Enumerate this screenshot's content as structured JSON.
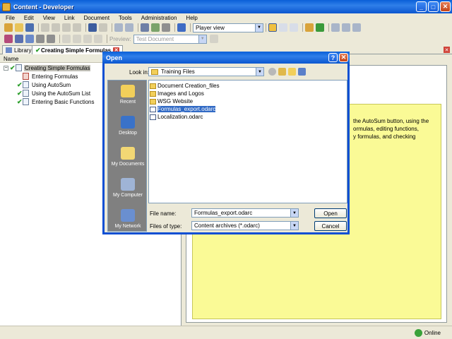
{
  "window": {
    "title": "Content - Developer"
  },
  "menu": [
    "File",
    "Edit",
    "View",
    "Link",
    "Document",
    "Tools",
    "Administration",
    "Help"
  ],
  "toolbar": {
    "view_mode": "Player view",
    "preview_label": "Preview:",
    "preview_value": "Test Document"
  },
  "tabs": [
    {
      "label": "Library"
    },
    {
      "label": "Creating Simple Formulas"
    }
  ],
  "outline": {
    "column_header": "Name",
    "root": "Creating Simple Formulas",
    "children": [
      "Entering Formulas",
      "Using AutoSum",
      "Using the AutoSum List",
      "Entering Basic Functions"
    ]
  },
  "description_lines": [
    "the AutoSum button, using the",
    "ormulas, editing functions,",
    "y formulas, and checking"
  ],
  "dialog": {
    "title": "Open",
    "look_in_label": "Look in:",
    "look_in_value": "Training Files",
    "places": [
      "Recent",
      "Desktop",
      "My Documents",
      "My Computer",
      "My Network"
    ],
    "files": [
      {
        "name": "Document Creation_files",
        "type": "folder"
      },
      {
        "name": "Images and Logos",
        "type": "folder"
      },
      {
        "name": "WSG Website",
        "type": "folder"
      },
      {
        "name": "Formulas_export.odarc",
        "type": "file"
      },
      {
        "name": "Localization.odarc",
        "type": "file"
      }
    ],
    "file_name_label": "File name:",
    "file_name_value": "Formulas_export.odarc",
    "file_type_label": "Files of type:",
    "file_type_value": "Content archives (*.odarc)",
    "open_button": "Open",
    "cancel_button": "Cancel"
  },
  "status": {
    "text": "Online"
  },
  "colors": {
    "title_bar": "#0b56cf",
    "note_background": "#fafa96",
    "selection": "#316ac5"
  }
}
